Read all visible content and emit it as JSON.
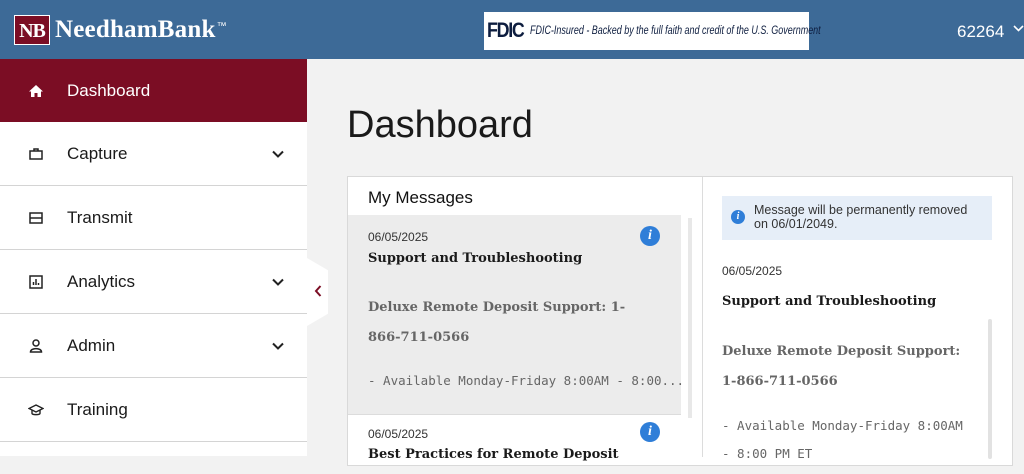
{
  "header": {
    "logo_mark": "NB",
    "logo_text": "NeedhamBank",
    "fdic_logo": "FDIC",
    "fdic_text": "FDIC-Insured - Backed by the full faith and credit of the U.S. Government",
    "account": "62264"
  },
  "sidebar": {
    "items": [
      {
        "label": "Dashboard",
        "icon": "home-icon",
        "active": true,
        "expandable": false
      },
      {
        "label": "Capture",
        "icon": "briefcase-icon",
        "active": false,
        "expandable": true
      },
      {
        "label": "Transmit",
        "icon": "tray-icon",
        "active": false,
        "expandable": false
      },
      {
        "label": "Analytics",
        "icon": "chart-icon",
        "active": false,
        "expandable": true
      },
      {
        "label": "Admin",
        "icon": "user-icon",
        "active": false,
        "expandable": true
      },
      {
        "label": "Training",
        "icon": "graduation-cap-icon",
        "active": false,
        "expandable": false
      }
    ]
  },
  "page": {
    "title": "Dashboard"
  },
  "messages": {
    "header": "My Messages",
    "items": [
      {
        "date": "06/05/2025",
        "title": "Support and Troubleshooting",
        "body1": "Deluxe Remote Deposit Support: 1-866-711-0566",
        "body2": "- Available Monday-Friday 8:00AM - 8:00..."
      },
      {
        "date": "06/05/2025",
        "title": "Best Practices for Remote Deposit"
      }
    ]
  },
  "detail": {
    "notice": "Message will be permanently removed on 06/01/2049.",
    "date": "06/05/2025",
    "title": "Support and Troubleshooting",
    "body1": "Deluxe Remote Deposit Support: 1-866-711-0566",
    "body2": "- Available Monday-Friday 8:00AM - 8:00 PM ET"
  },
  "colors": {
    "header_bg": "#3d6a97",
    "brand": "#7b0d24",
    "info": "#2f7ed8"
  }
}
